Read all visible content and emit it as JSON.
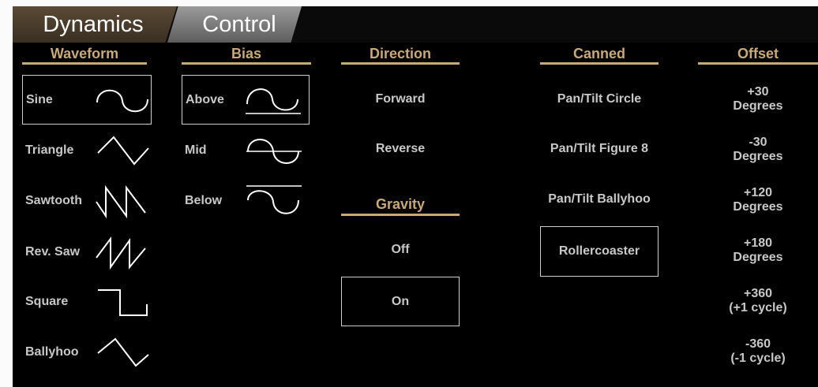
{
  "tabs": [
    {
      "label": "Dynamics",
      "active": true
    },
    {
      "label": "Control",
      "active": false
    }
  ],
  "columns": {
    "waveform": {
      "header": "Waveform",
      "items": [
        {
          "label": "Sine",
          "icon": "sine-wave-icon",
          "selected": true
        },
        {
          "label": "Triangle",
          "icon": "triangle-wave-icon",
          "selected": false
        },
        {
          "label": "Sawtooth",
          "icon": "sawtooth-wave-icon",
          "selected": false
        },
        {
          "label": "Rev. Saw",
          "icon": "reverse-saw-wave-icon",
          "selected": false
        },
        {
          "label": "Square",
          "icon": "square-wave-icon",
          "selected": false
        },
        {
          "label": "Ballyhoo",
          "icon": "ballyhoo-wave-icon",
          "selected": false
        }
      ]
    },
    "bias": {
      "header": "Bias",
      "items": [
        {
          "label": "Above",
          "icon": "bias-above-icon",
          "selected": true
        },
        {
          "label": "Mid",
          "icon": "bias-mid-icon",
          "selected": false
        },
        {
          "label": "Below",
          "icon": "bias-below-icon",
          "selected": false
        }
      ]
    },
    "direction": {
      "header": "Direction",
      "items": [
        {
          "label": "Forward",
          "selected": false
        },
        {
          "label": "Reverse",
          "selected": false
        }
      ]
    },
    "gravity": {
      "header": "Gravity",
      "items": [
        {
          "label": "Off",
          "selected": false
        },
        {
          "label": "On",
          "selected": true
        }
      ]
    },
    "canned": {
      "header": "Canned",
      "items": [
        {
          "label": "Pan/Tilt Circle",
          "selected": false
        },
        {
          "label": "Pan/Tilt Figure 8",
          "selected": false
        },
        {
          "label": "Pan/Tilt Ballyhoo",
          "selected": false
        },
        {
          "label": "Rollercoaster",
          "selected": true
        }
      ]
    },
    "offset": {
      "header": "Offset",
      "items": [
        {
          "line1": "+30",
          "line2": "Degrees"
        },
        {
          "line1": "-30",
          "line2": "Degrees"
        },
        {
          "line1": "+120",
          "line2": "Degrees"
        },
        {
          "line1": "+180",
          "line2": "Degrees"
        },
        {
          "line1": "+360",
          "line2": "(+1 cycle)"
        },
        {
          "line1": "-360",
          "line2": "(-1 cycle)"
        }
      ]
    }
  },
  "colors": {
    "header_gold": "#c9a977",
    "text": "#c8c8c8",
    "background": "#000000"
  }
}
